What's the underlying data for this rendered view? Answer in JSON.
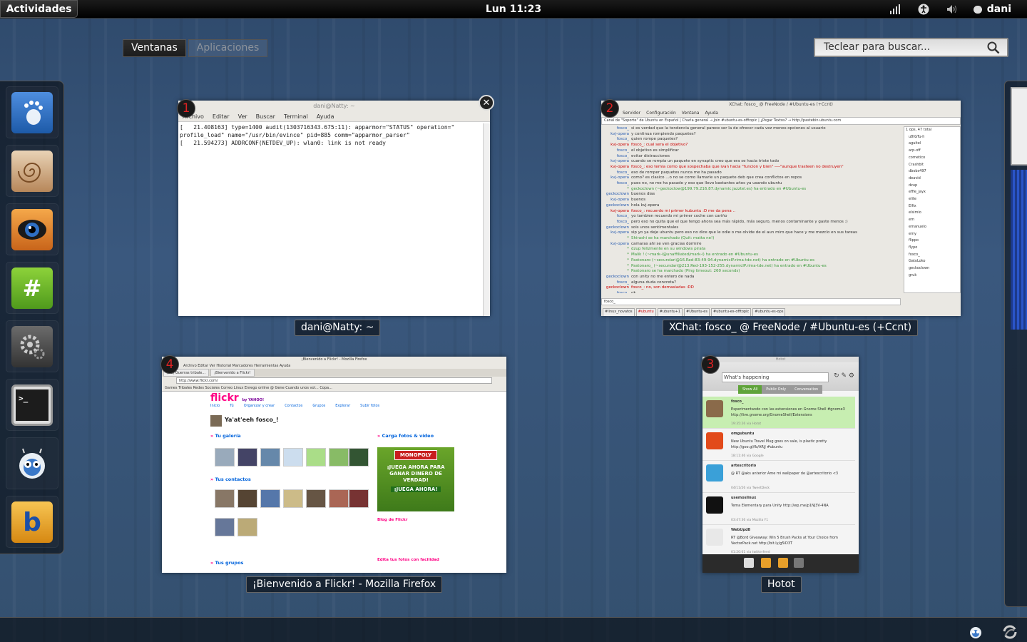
{
  "top_panel": {
    "activities_label": "Actividades",
    "clock": "Lun 11:23",
    "user_name": "dani",
    "tray_icons": [
      "signal-bars-icon",
      "accessibility-icon",
      "volume-icon",
      "chat-status-icon"
    ]
  },
  "view_selector": {
    "windows_label": "Ventanas",
    "applications_label": "Aplicaciones"
  },
  "search": {
    "placeholder": "Teclear para buscar..."
  },
  "dash": {
    "items": [
      {
        "name": "gnome-foot",
        "icon": "gnome-foot-icon",
        "color": "#2f6fbd"
      },
      {
        "name": "nautilus",
        "icon": "nautilus-shell-icon",
        "color": "#c9a27a"
      },
      {
        "name": "eog",
        "icon": "eye-of-gnome-icon",
        "color": "#e08a1e"
      },
      {
        "name": "xchat",
        "icon": "xchat-hash-icon",
        "color": "#6cb52f"
      },
      {
        "name": "settings",
        "icon": "gears-icon",
        "color": "#555555"
      },
      {
        "name": "terminal",
        "icon": "terminal-icon",
        "color": "#222222"
      },
      {
        "name": "hotot",
        "icon": "hotot-owl-icon",
        "color": "#d8e6f2"
      },
      {
        "name": "banshee",
        "icon": "banshee-icon",
        "color": "#f0a81c"
      }
    ]
  },
  "windows": {
    "terminal": {
      "number": "1",
      "title": "dani@Natty: ~",
      "caption": "dani@Natty: ~",
      "menu": [
        "Archivo",
        "Editar",
        "Ver",
        "Buscar",
        "Terminal",
        "Ayuda"
      ],
      "lines": [
        "[   21.408163] type=1400 audit(1303716343.675:11): apparmor=\"STATUS\" operation=\"",
        "profile_load\" name=\"/usr/bin/evince\" pid=885 comm=\"apparmor_parser\"",
        "[   21.594273] ADDRCONF(NETDEV_UP): wlan0: link is not ready"
      ]
    },
    "xchat": {
      "number": "2",
      "title": "XChat: fosco_ @ FreeNode / #Ubuntu-es (+Ccnt)",
      "caption": "XChat: fosco_ @ FreeNode / #Ubuntu-es (+Ccnt)",
      "menu": [
        "XChat",
        "Servidor",
        "Configuración",
        "Ventana",
        "Ayuda"
      ],
      "topic": "Canal de \"Soporte\" de Ubuntu en Español | Charla general → Join #ubuntu-es-offtopic | ¿Pegar Textos? → http://pastebin.ubuntu.com",
      "user_count": "1 ops, 47 total",
      "chat": [
        {
          "nick": "fosco_",
          "cls": "",
          "text": "si es verdad que la tendencia general parece ser la de ofrecer cada vez menos opciones al usuario"
        },
        {
          "nick": "kvj-opera",
          "cls": "",
          "text": "y continua rompiendo paquetes?"
        },
        {
          "nick": "fosco_",
          "cls": "",
          "text": "quien rompe paquetes?"
        },
        {
          "nick": "kvj-opera",
          "cls": "r",
          "text": "fosco_: cual sera el objetivo?"
        },
        {
          "nick": "fosco_",
          "cls": "",
          "text": "el objetivo es simplificar"
        },
        {
          "nick": "fosco_",
          "cls": "",
          "text": "evitar distracciones"
        },
        {
          "nick": "kvj-opera",
          "cls": "",
          "text": "cuando se rompia un paquete en synaptic creo que era se hacia triste todo"
        },
        {
          "nick": "kvj-opera",
          "cls": "r",
          "text": "fosco_: eso temia como que sospechaba que ivan hacia \"funcion y bien\" ----\"aunque trasteen no destruyen\""
        },
        {
          "nick": "fosco_",
          "cls": "",
          "text": "eso de romper paquetes nunca me ha pasado"
        },
        {
          "nick": "kvj-opera",
          "cls": "",
          "text": "como? es clasico ...o no se como llamarle un paquete deb que crea conflictos en repos"
        },
        {
          "nick": "fosco_",
          "cls": "",
          "text": "pues no, no me ha pasado y eso que llevo bastantes años ya usando ubuntu"
        },
        {
          "nick": "*",
          "cls": "g",
          "text": "geckoclown (~geckoclow@199.79.216.87.dynamic.jazztel.es) ha entrado en #Ubuntu-es"
        },
        {
          "nick": "geckoclown",
          "cls": "",
          "text": "buenos dias"
        },
        {
          "nick": "kvj-opera",
          "cls": "",
          "text": "buenos"
        },
        {
          "nick": "geckoclown",
          "cls": "",
          "text": "hola kvj-opera"
        },
        {
          "nick": "kvj-opera",
          "cls": "r",
          "text": "fosco_: recuerdo mi primer kubuntu :D me da pena .."
        },
        {
          "nick": "fosco_",
          "cls": "",
          "text": "yo tambien recuerdo mi primer coche con cariño"
        },
        {
          "nick": "fosco_",
          "cls": "",
          "text": "pero eso no quita que el que tengo ahora sea más rápido, más seguro, menos contaminante y gaste menos :)"
        },
        {
          "nick": "geckoclown",
          "cls": "",
          "text": "sois unos sentimentales"
        },
        {
          "nick": "kvj-opera",
          "cls": "",
          "text": "sip yo ya deje ubuntu pero eso no dice que le odie o me olvide de el aun miro que hace y me mezclo en sus tareas"
        },
        {
          "nick": "*",
          "cls": "g",
          "text": "Shirashi se ha marchado (Quit: matta ne!)"
        },
        {
          "nick": "kvj-opera",
          "cls": "",
          "text": "camaras ahi se ven gracias dormire"
        },
        {
          "nick": "*",
          "cls": "g",
          "text": "dzup felizmente en su windows pirata"
        },
        {
          "nick": "*",
          "cls": "g",
          "text": "Malik ! (~mark-i@unaffiliated/mark-i) ha entrado en #Ubuntu-es"
        },
        {
          "nick": "*",
          "cls": "g",
          "text": "Pastonaro (~secundari@16.Red-83-49-94.dynamicIP.rima-tde.net) ha entrado en #Ubuntu-es"
        },
        {
          "nick": "*",
          "cls": "g",
          "text": "Pastonaro_ (~secundari@213.Red-193-152-255.dynamicIP.rima-tde.net) ha entrado en #Ubuntu-es"
        },
        {
          "nick": "*",
          "cls": "g",
          "text": "Pastonaro se ha marchado (Ping timeout: 260 seconds)"
        },
        {
          "nick": "geckoclown",
          "cls": "",
          "text": "con unity no me entero de nada"
        },
        {
          "nick": "fosco_",
          "cls": "",
          "text": "alguna duda concreta?"
        },
        {
          "nick": "geckoclown",
          "cls": "r",
          "text": "fosco_: no, son demasiadas :DD"
        },
        {
          "nick": "fosco_",
          "cls": "",
          "text": "ok"
        }
      ],
      "nicks": [
        "u8tGTu-h",
        "aguitel",
        "arp-off",
        "cornetico",
        "Crashbit",
        "dbobs497",
        "deavid",
        "dzup",
        "effie_jayx",
        "elite",
        "Elfix",
        "elsimio",
        "em",
        "emanuelo",
        "emy",
        "flippo",
        "flypo",
        "fosco_",
        "GatoLoko",
        "geckoclown",
        "gruk"
      ],
      "lag": "0.0s",
      "bytes": "0 bytes",
      "op_buttons": [
        "Op",
        "Quitar Op",
        "Banear",
        "Echar",
        "Enviar archivo",
        "Diálogo"
      ],
      "input_nick": "fosco_",
      "tabs": [
        {
          "label": "#linux_novatos",
          "cls": ""
        },
        {
          "label": "#ubuntu",
          "cls": "red"
        },
        {
          "label": "#ubuntu+1",
          "cls": ""
        },
        {
          "label": "#Ubuntu-es",
          "cls": ""
        },
        {
          "label": "#ubuntu-es-offtopic",
          "cls": ""
        },
        {
          "label": "#ubuntu-es-ops",
          "cls": ""
        }
      ]
    },
    "firefox": {
      "number": "4",
      "title": "¡Bienvenido a Flickr! - Mozilla Firefox",
      "caption": "¡Bienvenido a Flickr! - Mozilla Firefox",
      "menu": "Archivo  Editar  Ver  Historial  Marcadores  Herramientas  Ayuda",
      "tabs": [
        "(21) Guerras tribale...",
        "¡Bienvenido a Flickr!"
      ],
      "url": "http://www.flickr.com/",
      "bookmarks": "Games Tribales  Redes Sociales  Correo  Linux  Enrego online @ Gene  Cuando unos vol...  Copa...",
      "logo_main": "flickr",
      "logo_suffix": "by YAHOO!",
      "nav": [
        "Inicio",
        "Tú",
        "Organizar y crear",
        "Contactos",
        "Grupos",
        "Explorar",
        "Subir fotos"
      ],
      "greeting": "Ya'at'eeh fosco_!",
      "sections": {
        "gallery": "Tu galería",
        "contacts": "Tus contactos",
        "groups": "Tus grupos",
        "upload": "Carga fotos & vídeo",
        "blog": "Blog de Flickr",
        "edit": "Edita tus fotos con facilidad"
      },
      "ad_brand": "MONOPOLY",
      "ad_text": "¡JUEGA AHORA PARA GANAR DINERO DE VERDAD!",
      "ad_cta": "¡JUEGA AHORA!"
    },
    "hotot": {
      "number": "3",
      "title": "Hotot",
      "caption": "Hotot",
      "search_text": "What's happening",
      "tabs": [
        "Show All",
        "Public Only",
        "Conversation"
      ],
      "tweets": [
        {
          "name": "fosco_",
          "text": "Experimentando con las extensiones en Gnome Shell #gnome3 http://live.gnome.org/GnomeShell/Extensions",
          "meta": "19:35:26 via Hotot",
          "color": "#8a6a4a",
          "hl": true
        },
        {
          "name": "omgubuntu",
          "text": "New Ubuntu Travel Mug goes on sale, is plastic pretty http://goo.gl/fb/ARjJ #ubuntu",
          "meta": "18:11:46 via Google",
          "color": "#e24a1a",
          "hl": false
        },
        {
          "name": "artescritorio",
          "text": "@ RT @aks anterior Ame mi wallpaper de @artescritorio <3",
          "meta": "04/11/26 via TweetDeck",
          "color": "#3aa0d8",
          "hl": false
        },
        {
          "name": "usemoslinux",
          "text": "Tema Elementary para Unity http://wp.me/p1NJ3V-4NA",
          "meta": "03:47:36 via Mozilla F1",
          "color": "#111111",
          "hl": false
        },
        {
          "name": "WebUpd8",
          "text": "RT @Bord Giveaway: Win 5 Brush Packs at Your Choice from VectorPack.net http://bit.ly/g5iD3T",
          "meta": "01:20:01 via twitterfeed",
          "color": "#e8e8e8",
          "hl": false
        }
      ]
    }
  },
  "bottom_tray": {
    "icons": [
      "hotot-tray-icon",
      "firefox-tray-icon"
    ]
  }
}
